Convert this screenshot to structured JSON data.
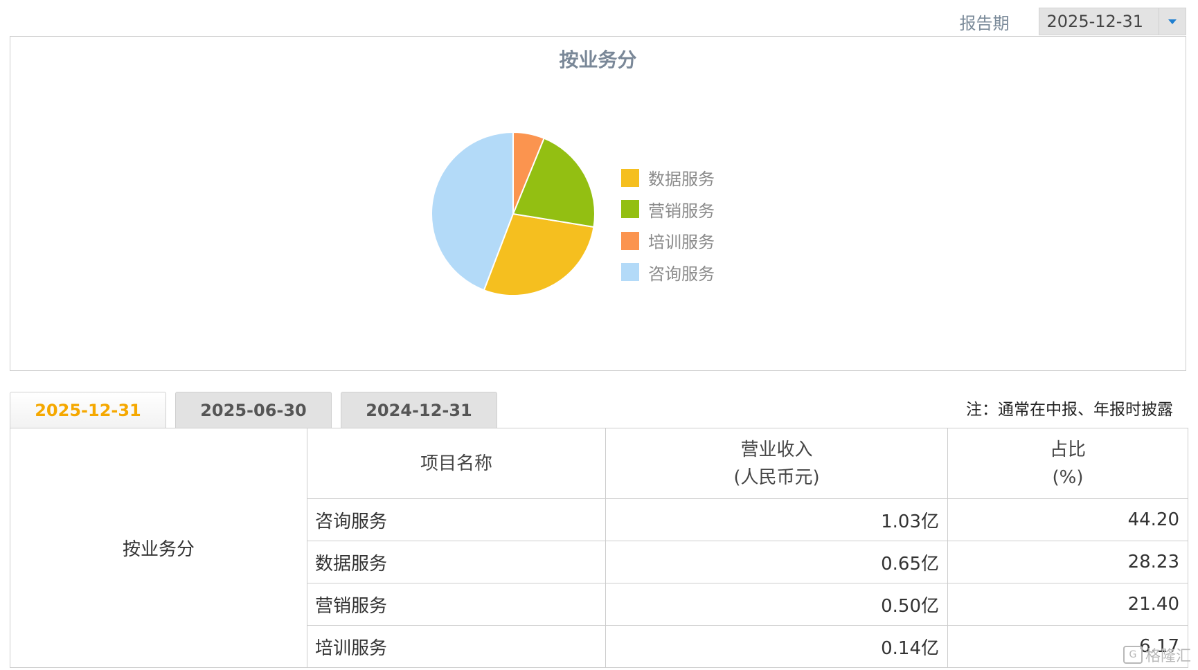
{
  "period": {
    "label": "报告期",
    "selected": "2025-12-31"
  },
  "chart_data": {
    "type": "pie",
    "title": "按业务分",
    "categories": [
      "咨询服务",
      "数据服务",
      "营销服务",
      "培训服务"
    ],
    "values": [
      44.2,
      28.23,
      21.4,
      6.17
    ],
    "colors": [
      "#b3daf8",
      "#f5bf1f",
      "#93bf12",
      "#fb944f"
    ],
    "legend": {
      "placement": "right",
      "entries": [
        {
          "label": "数据服务",
          "color": "#f5bf1f"
        },
        {
          "label": "营销服务",
          "color": "#93bf12"
        },
        {
          "label": "培训服务",
          "color": "#fb944f"
        },
        {
          "label": "咨询服务",
          "color": "#b3daf8"
        }
      ]
    }
  },
  "tabs": [
    {
      "label": "2025-12-31",
      "active": true
    },
    {
      "label": "2025-06-30",
      "active": false
    },
    {
      "label": "2024-12-31",
      "active": false
    }
  ],
  "note": "注：通常在中报、年报时披露",
  "table": {
    "headers": {
      "name": "项目名称",
      "revenue_line1": "营业收入",
      "revenue_line2": "(人民币元)",
      "pct_line1": "占比",
      "pct_line2": "(%)"
    },
    "category": "按业务分",
    "rows": [
      {
        "name": "咨询服务",
        "revenue": "1.03亿",
        "pct": "44.20"
      },
      {
        "name": "数据服务",
        "revenue": "0.65亿",
        "pct": "28.23"
      },
      {
        "name": "营销服务",
        "revenue": "0.50亿",
        "pct": "21.40"
      },
      {
        "name": "培训服务",
        "revenue": "0.14亿",
        "pct": "6.17"
      }
    ]
  },
  "watermark": "格隆汇"
}
